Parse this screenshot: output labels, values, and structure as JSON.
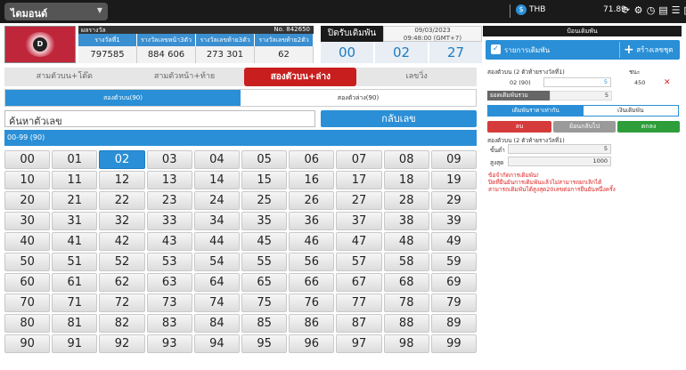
{
  "topbar": {
    "lottery_select": "ไดมอนด์",
    "currency": "THB",
    "balance": "71.89"
  },
  "result": {
    "round_label": "ผลรางวัล",
    "round_no": "No. 842650",
    "columns": [
      "รางวัลที่1",
      "รางวัลเลขหน้า3ตัว",
      "รางวัลเลขท้าย3ตัว",
      "รางวัลเลขท้าย2ตัว"
    ],
    "values": [
      "797585",
      "884  606",
      "273  301",
      "62"
    ]
  },
  "close": {
    "label": "ปิดรับเดิมพัน",
    "date": "09/03/2023",
    "time": "09:48:00 (GMT+7)",
    "countdown": [
      "00",
      "02",
      "27"
    ]
  },
  "tabs": {
    "main": [
      "สามตัวบน+โต๊ด",
      "สามตัวหน้า+ท้าย",
      "สองตัวบน+ล่าง",
      "เลขวิ่ง"
    ],
    "active_main": 2,
    "sub": [
      "สองตัวบน(90)",
      "สองตัวล่าง(90)"
    ],
    "active_sub": 0
  },
  "search": {
    "placeholder": "ค้นหาตัวเลข",
    "button": "กลับเลข"
  },
  "range_label": "00-99 (90)",
  "numbers": [
    "00",
    "01",
    "02",
    "03",
    "04",
    "05",
    "06",
    "07",
    "08",
    "09",
    "10",
    "11",
    "12",
    "13",
    "14",
    "15",
    "16",
    "17",
    "18",
    "19",
    "20",
    "21",
    "22",
    "23",
    "24",
    "25",
    "26",
    "27",
    "28",
    "29",
    "30",
    "31",
    "32",
    "33",
    "34",
    "35",
    "36",
    "37",
    "38",
    "39",
    "40",
    "41",
    "42",
    "43",
    "44",
    "45",
    "46",
    "47",
    "48",
    "49",
    "50",
    "51",
    "52",
    "53",
    "54",
    "55",
    "56",
    "57",
    "58",
    "59",
    "60",
    "61",
    "62",
    "63",
    "64",
    "65",
    "66",
    "67",
    "68",
    "69",
    "70",
    "71",
    "72",
    "73",
    "74",
    "75",
    "76",
    "77",
    "78",
    "79",
    "80",
    "81",
    "82",
    "83",
    "84",
    "85",
    "86",
    "87",
    "88",
    "89",
    "90",
    "91",
    "92",
    "93",
    "94",
    "95",
    "96",
    "97",
    "98",
    "99"
  ],
  "selected_number": "02",
  "bet_panel": {
    "header": "ป้อนเดิมพัน",
    "list_title": "รายการเดิมพัน",
    "create_set": "สร้างเลขชุด",
    "bet_type": "สองตัวบน (2 ตัวท้ายรางวัลที่1)",
    "win_label": "ชนะ",
    "bet_number": "02 (90)",
    "bet_amount": "5",
    "bet_win": "450",
    "total_label": "ยอดเดิมพันรวม",
    "total_value": "5",
    "seg_options": [
      "เดิมพันราคาเท่ากัน",
      "เงินเดิมพัน"
    ],
    "btn_delete": "ลบ",
    "btn_back": "ย้อนกลับไป",
    "btn_ok": "ตกลง",
    "rule_title": "สองตัวบน (2 ตัวท้ายรางวัลที่1)",
    "min_label": "ขั้นต่ำ",
    "min_value": "5",
    "max_label": "สูงสุด",
    "max_value": "1000",
    "note_title": "ข้อจำกัดการเดิมพัน!",
    "note_line1": "ปิดที่ยืนยันการเดิมพันแล้วไม่สามารถยกเลิกได้",
    "note_line2": "สามารถเดิมพันได้สูงสุด20เลขต่อการยืนยันหนึ่งครั้ง"
  },
  "colors": {
    "accent": "#2a8fd6",
    "active_tab": "#c81e1e",
    "ok": "#2e9e3a",
    "delete": "#d63b3b"
  }
}
